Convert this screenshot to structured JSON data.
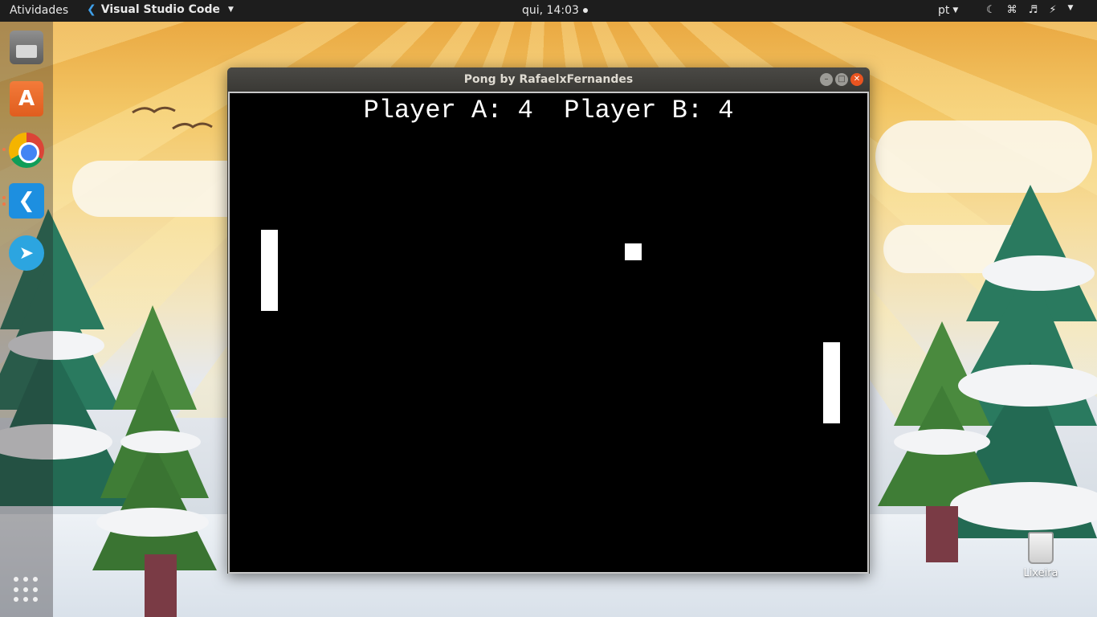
{
  "topbar": {
    "activities": "Atividades",
    "app_name": "Visual Studio Code",
    "clock": "qui, 14:03",
    "language": "pt",
    "indicators": [
      "night-light-icon",
      "wifi-icon",
      "volume-icon",
      "power-icon"
    ]
  },
  "dock": {
    "items": [
      "files",
      "software-store",
      "chrome",
      "vscode",
      "telegram"
    ],
    "show_apps_icon": "grid-icon"
  },
  "desktop": {
    "trash_label": "Lixeira"
  },
  "window": {
    "title": "Pong by RafaelxFernandes",
    "score_text": "Player A: 4  Player B: 4",
    "background_color": "#000000",
    "object_color": "#ffffff"
  }
}
